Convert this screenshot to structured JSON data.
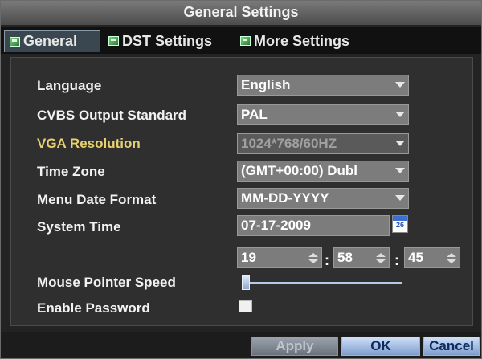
{
  "window": {
    "title": "General Settings"
  },
  "tabs": [
    {
      "label": "General",
      "active": true
    },
    {
      "label": "DST Settings",
      "active": false
    },
    {
      "label": "More Settings",
      "active": false
    }
  ],
  "settings": {
    "language": {
      "label": "Language",
      "value": "English"
    },
    "cvbs": {
      "label": "CVBS Output Standard",
      "value": "PAL"
    },
    "vga": {
      "label": "VGA Resolution",
      "value": "1024*768/60HZ"
    },
    "timezone": {
      "label": "Time Zone",
      "value": "(GMT+00:00) Dubl"
    },
    "date_format": {
      "label": "Menu Date Format",
      "value": "MM-DD-YYYY"
    },
    "system_time": {
      "label": "System Time",
      "date": "07-17-2009",
      "hour": "19",
      "minute": "58",
      "second": "45",
      "calendar_day": "26"
    },
    "mouse_speed": {
      "label": "Mouse Pointer Speed",
      "level": 0.02
    },
    "password": {
      "label": "Enable Password",
      "checked": false
    }
  },
  "buttons": {
    "apply": "Apply",
    "ok": "OK",
    "cancel": "Cancel"
  },
  "colors": {
    "accent": "#8da6d0",
    "label_highlight": "#e8d070"
  }
}
